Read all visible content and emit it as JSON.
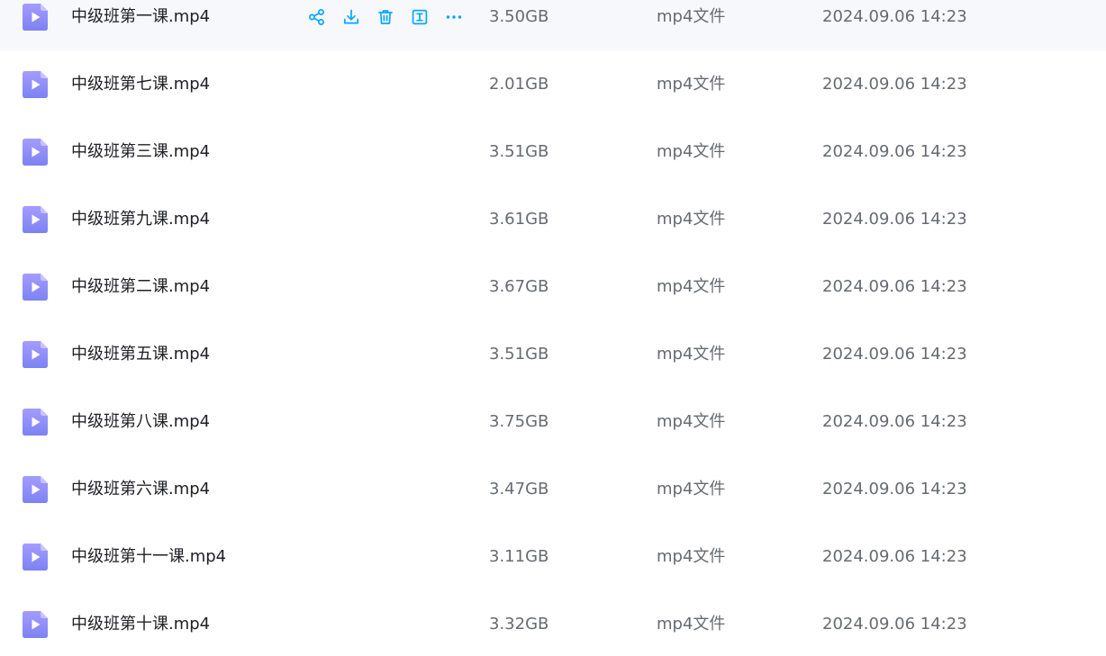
{
  "colors": {
    "accent": "#06a7ff",
    "icon_top": "#a59cff",
    "icon_bottom": "#7c82f2",
    "hover_bg": "#f7f8fc",
    "name_text": "#202124",
    "meta_text": "#676a70"
  },
  "row_actions": [
    {
      "icon": "share-icon"
    },
    {
      "icon": "download-icon"
    },
    {
      "icon": "delete-icon"
    },
    {
      "icon": "rename-icon"
    },
    {
      "icon": "more-icon"
    }
  ],
  "files": [
    {
      "name": "中级班第一课.mp4",
      "size": "3.50GB",
      "type": "mp4文件",
      "date": "2024.09.06 14:23",
      "hovered": true,
      "icon": "video-file-icon"
    },
    {
      "name": "中级班第七课.mp4",
      "size": "2.01GB",
      "type": "mp4文件",
      "date": "2024.09.06 14:23",
      "hovered": false,
      "icon": "video-file-icon"
    },
    {
      "name": "中级班第三课.mp4",
      "size": "3.51GB",
      "type": "mp4文件",
      "date": "2024.09.06 14:23",
      "hovered": false,
      "icon": "video-file-icon"
    },
    {
      "name": "中级班第九课.mp4",
      "size": "3.61GB",
      "type": "mp4文件",
      "date": "2024.09.06 14:23",
      "hovered": false,
      "icon": "video-file-icon"
    },
    {
      "name": "中级班第二课.mp4",
      "size": "3.67GB",
      "type": "mp4文件",
      "date": "2024.09.06 14:23",
      "hovered": false,
      "icon": "video-file-icon"
    },
    {
      "name": "中级班第五课.mp4",
      "size": "3.51GB",
      "type": "mp4文件",
      "date": "2024.09.06 14:23",
      "hovered": false,
      "icon": "video-file-icon"
    },
    {
      "name": "中级班第八课.mp4",
      "size": "3.75GB",
      "type": "mp4文件",
      "date": "2024.09.06 14:23",
      "hovered": false,
      "icon": "video-file-icon"
    },
    {
      "name": "中级班第六课.mp4",
      "size": "3.47GB",
      "type": "mp4文件",
      "date": "2024.09.06 14:23",
      "hovered": false,
      "icon": "video-file-icon"
    },
    {
      "name": "中级班第十一课.mp4",
      "size": "3.11GB",
      "type": "mp4文件",
      "date": "2024.09.06 14:23",
      "hovered": false,
      "icon": "video-file-icon"
    },
    {
      "name": "中级班第十课.mp4",
      "size": "3.32GB",
      "type": "mp4文件",
      "date": "2024.09.06 14:23",
      "hovered": false,
      "icon": "video-file-icon"
    }
  ]
}
